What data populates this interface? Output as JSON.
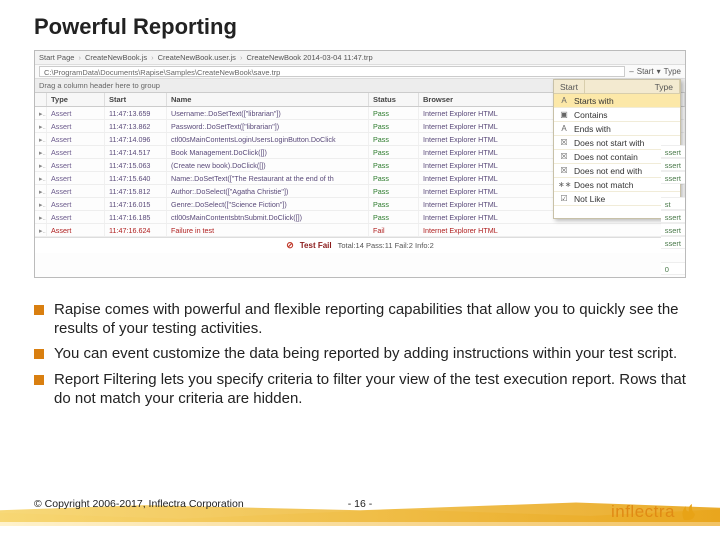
{
  "title": "Powerful Reporting",
  "breadcrumb": {
    "seg1": "Start Page",
    "seg2": "CreateNewBook.js",
    "seg3": "CreateNewBook.user.js",
    "seg4": "CreateNewBook   2014-03-04   11:47.trp"
  },
  "pathbar": {
    "path": "C:\\ProgramData\\Documents\\Rapise\\Samples\\CreateNewBook\\save.trp"
  },
  "toolbar": {
    "startLabel": "Start",
    "typeLabel": "Type",
    "dash": "–"
  },
  "groupHeader": "Drag a column header here to group",
  "columns": {
    "exp": "",
    "type": "Type",
    "start": "Start",
    "name": "Name",
    "status": "Status",
    "browser": "Browser"
  },
  "rows": [
    {
      "type": "Assert",
      "start": "11:47:13.659",
      "name": "Username:.DoSetText([\"librarian\"])",
      "status": "Pass",
      "browser": "Internet Explorer HTML"
    },
    {
      "type": "Assert",
      "start": "11:47:13.862",
      "name": "Password:.DoSetText([\"librarian\"])",
      "status": "Pass",
      "browser": "Internet Explorer HTML"
    },
    {
      "type": "Assert",
      "start": "11:47:14.096",
      "name": "ctl00sMainContentsLoginUsersLoginButton.DoClick",
      "status": "Pass",
      "browser": "Internet Explorer HTML"
    },
    {
      "type": "Assert",
      "start": "11:47:14.517",
      "name": "Book Management.DoClick([])",
      "status": "Pass",
      "browser": "Internet Explorer HTML"
    },
    {
      "type": "Assert",
      "start": "11:47:15.063",
      "name": "(Create new book).DoClick([])",
      "status": "Pass",
      "browser": "Internet Explorer HTML"
    },
    {
      "type": "Assert",
      "start": "11:47:15.640",
      "name": "Name:.DoSetText([\"The Restaurant at the end of th",
      "status": "Pass",
      "browser": "Internet Explorer HTML"
    },
    {
      "type": "Assert",
      "start": "11:47:15.812",
      "name": "Author:.DoSelect([\"Agatha Christie\"])",
      "status": "Pass",
      "browser": "Internet Explorer HTML"
    },
    {
      "type": "Assert",
      "start": "11:47:16.015",
      "name": "Genre:.DoSelect([\"Science Fiction\"])",
      "status": "Pass",
      "browser": "Internet Explorer HTML"
    },
    {
      "type": "Assert",
      "start": "11:47:16.185",
      "name": "ctl00sMainContentsbtnSubmit.DoClick([])",
      "status": "Pass",
      "browser": "Internet Explorer HTML"
    },
    {
      "type": "Assert",
      "start": "11:47:16.624",
      "name": "Failure in test",
      "status": "Fail",
      "browser": "Internet Explorer HTML"
    }
  ],
  "summary": {
    "label": "Test Fail",
    "sub": "Total:14 Pass:11 Fail:2 Info:2"
  },
  "filter": {
    "hdrStart": "Start",
    "hdrType": "Type",
    "items": [
      {
        "g": "A",
        "t": "Starts with",
        "sel": true
      },
      {
        "g": "▣",
        "t": "Contains"
      },
      {
        "g": "A",
        "t": "Ends with"
      },
      {
        "g": "☒",
        "t": "Does not start with"
      },
      {
        "g": "☒",
        "t": "Does not contain"
      },
      {
        "g": "☒",
        "t": "Does not end with"
      },
      {
        "g": "∗∗",
        "t": "Does not match"
      },
      {
        "g": "☑",
        "t": "Not Like"
      }
    ],
    "arrow": "▾"
  },
  "rbadges": [
    "ssert",
    "ssert",
    "ssert",
    "",
    "st",
    "ssert",
    "ssert",
    "ssert",
    "",
    "0"
  ],
  "bullets": [
    "Rapise comes with powerful and flexible reporting capabilities that allow you to quickly see the results of your testing activities.",
    "You can event customize the data being reported by adding instructions within your test script.",
    "Report Filtering lets you specify criteria to filter your view of the test execution report. Rows that do not match your criteria are hidden."
  ],
  "footer": {
    "copyright": "© Copyright 2006-2017, Inflectra Corporation",
    "page": "- 16 -",
    "brand": "inflectra"
  }
}
